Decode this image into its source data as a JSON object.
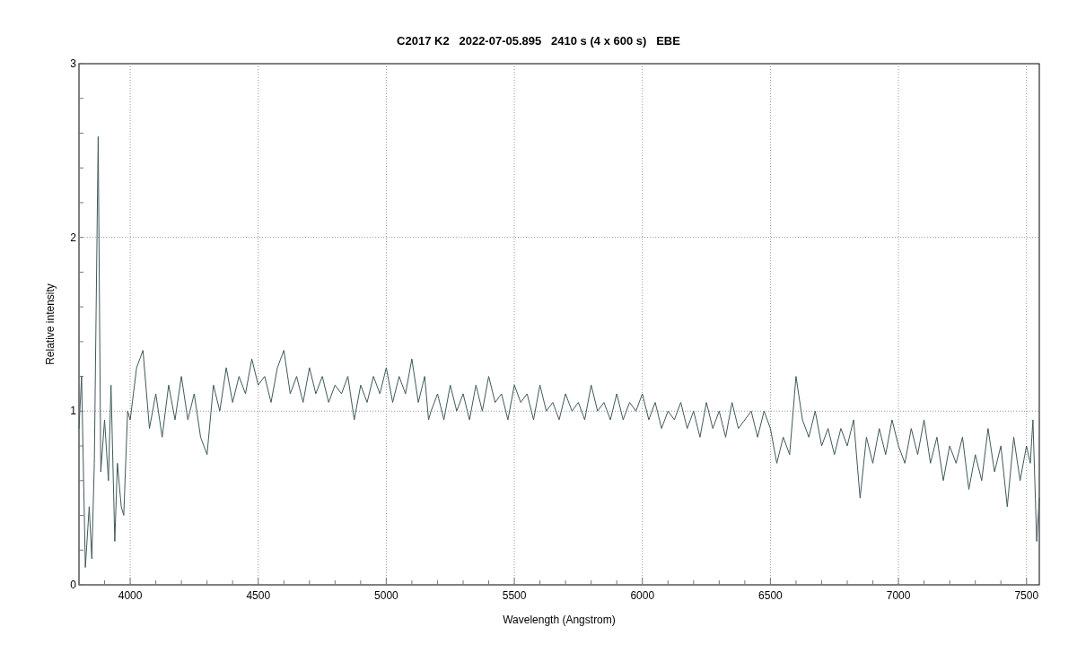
{
  "chart_data": {
    "type": "line",
    "title": "C2017 K2   2022-07-05.895   2410 s (4 x 600 s)   EBE",
    "xlabel": "Wavelength (Angstrom)",
    "ylabel": "Relative intensity",
    "x": [
      3800,
      3810,
      3825,
      3840,
      3850,
      3860,
      3875,
      3885,
      3900,
      3915,
      3925,
      3940,
      3950,
      3965,
      3975,
      3990,
      4000,
      4025,
      4050,
      4075,
      4100,
      4125,
      4150,
      4175,
      4200,
      4225,
      4250,
      4275,
      4300,
      4325,
      4350,
      4375,
      4400,
      4425,
      4450,
      4475,
      4500,
      4525,
      4550,
      4575,
      4600,
      4625,
      4650,
      4675,
      4700,
      4725,
      4750,
      4775,
      4800,
      4825,
      4850,
      4875,
      4900,
      4925,
      4950,
      4975,
      5000,
      5025,
      5050,
      5075,
      5100,
      5125,
      5150,
      5165,
      5175,
      5200,
      5225,
      5250,
      5275,
      5300,
      5325,
      5350,
      5375,
      5400,
      5425,
      5450,
      5475,
      5500,
      5525,
      5550,
      5575,
      5600,
      5625,
      5650,
      5675,
      5700,
      5725,
      5750,
      5775,
      5800,
      5825,
      5850,
      5875,
      5900,
      5925,
      5950,
      5975,
      6000,
      6025,
      6050,
      6075,
      6100,
      6125,
      6150,
      6175,
      6200,
      6225,
      6250,
      6275,
      6300,
      6325,
      6350,
      6375,
      6400,
      6425,
      6450,
      6475,
      6500,
      6525,
      6550,
      6575,
      6600,
      6625,
      6650,
      6675,
      6700,
      6725,
      6750,
      6775,
      6800,
      6825,
      6850,
      6875,
      6900,
      6925,
      6950,
      6975,
      7000,
      7025,
      7050,
      7075,
      7100,
      7125,
      7150,
      7175,
      7200,
      7225,
      7250,
      7275,
      7300,
      7325,
      7350,
      7375,
      7400,
      7425,
      7450,
      7475,
      7500,
      7515,
      7525,
      7540,
      7550
    ],
    "series": [
      {
        "color": "#41595a",
        "values": [
          0.9,
          1.2,
          0.1,
          0.45,
          0.15,
          0.7,
          2.58,
          0.65,
          0.95,
          0.6,
          1.15,
          0.25,
          0.7,
          0.45,
          0.4,
          1.0,
          0.95,
          1.25,
          1.35,
          0.9,
          1.1,
          0.85,
          1.15,
          0.95,
          1.2,
          0.95,
          1.1,
          0.85,
          0.75,
          1.15,
          1.0,
          1.25,
          1.05,
          1.2,
          1.1,
          1.3,
          1.15,
          1.2,
          1.05,
          1.25,
          1.35,
          1.1,
          1.2,
          1.05,
          1.25,
          1.1,
          1.2,
          1.05,
          1.15,
          1.1,
          1.2,
          0.95,
          1.15,
          1.05,
          1.2,
          1.1,
          1.25,
          1.05,
          1.2,
          1.1,
          1.3,
          1.05,
          1.2,
          0.95,
          1.0,
          1.1,
          0.95,
          1.15,
          1.0,
          1.1,
          0.95,
          1.15,
          1.0,
          1.2,
          1.05,
          1.1,
          0.95,
          1.15,
          1.05,
          1.1,
          0.95,
          1.15,
          1.0,
          1.05,
          0.95,
          1.1,
          1.0,
          1.05,
          0.95,
          1.15,
          1.0,
          1.05,
          0.95,
          1.1,
          0.95,
          1.05,
          1.0,
          1.1,
          0.95,
          1.05,
          0.9,
          1.0,
          0.95,
          1.05,
          0.9,
          1.0,
          0.85,
          1.05,
          0.9,
          1.0,
          0.85,
          1.05,
          0.9,
          0.95,
          1.0,
          0.85,
          1.0,
          0.9,
          0.7,
          0.85,
          0.75,
          1.2,
          0.95,
          0.85,
          1.0,
          0.8,
          0.9,
          0.75,
          0.9,
          0.8,
          0.95,
          0.5,
          0.85,
          0.7,
          0.9,
          0.75,
          0.95,
          0.8,
          0.7,
          0.9,
          0.75,
          0.95,
          0.7,
          0.85,
          0.6,
          0.8,
          0.7,
          0.85,
          0.55,
          0.75,
          0.6,
          0.9,
          0.65,
          0.8,
          0.45,
          0.85,
          0.6,
          0.8,
          0.7,
          0.95,
          0.25,
          0.5
        ]
      }
    ],
    "xlim": [
      3800,
      7550
    ],
    "ylim": [
      0,
      3
    ],
    "xticks": [
      4000,
      4500,
      5000,
      5500,
      6000,
      6500,
      7000,
      7500
    ],
    "yticks": [
      0,
      1,
      2,
      3
    ],
    "grid": true
  }
}
